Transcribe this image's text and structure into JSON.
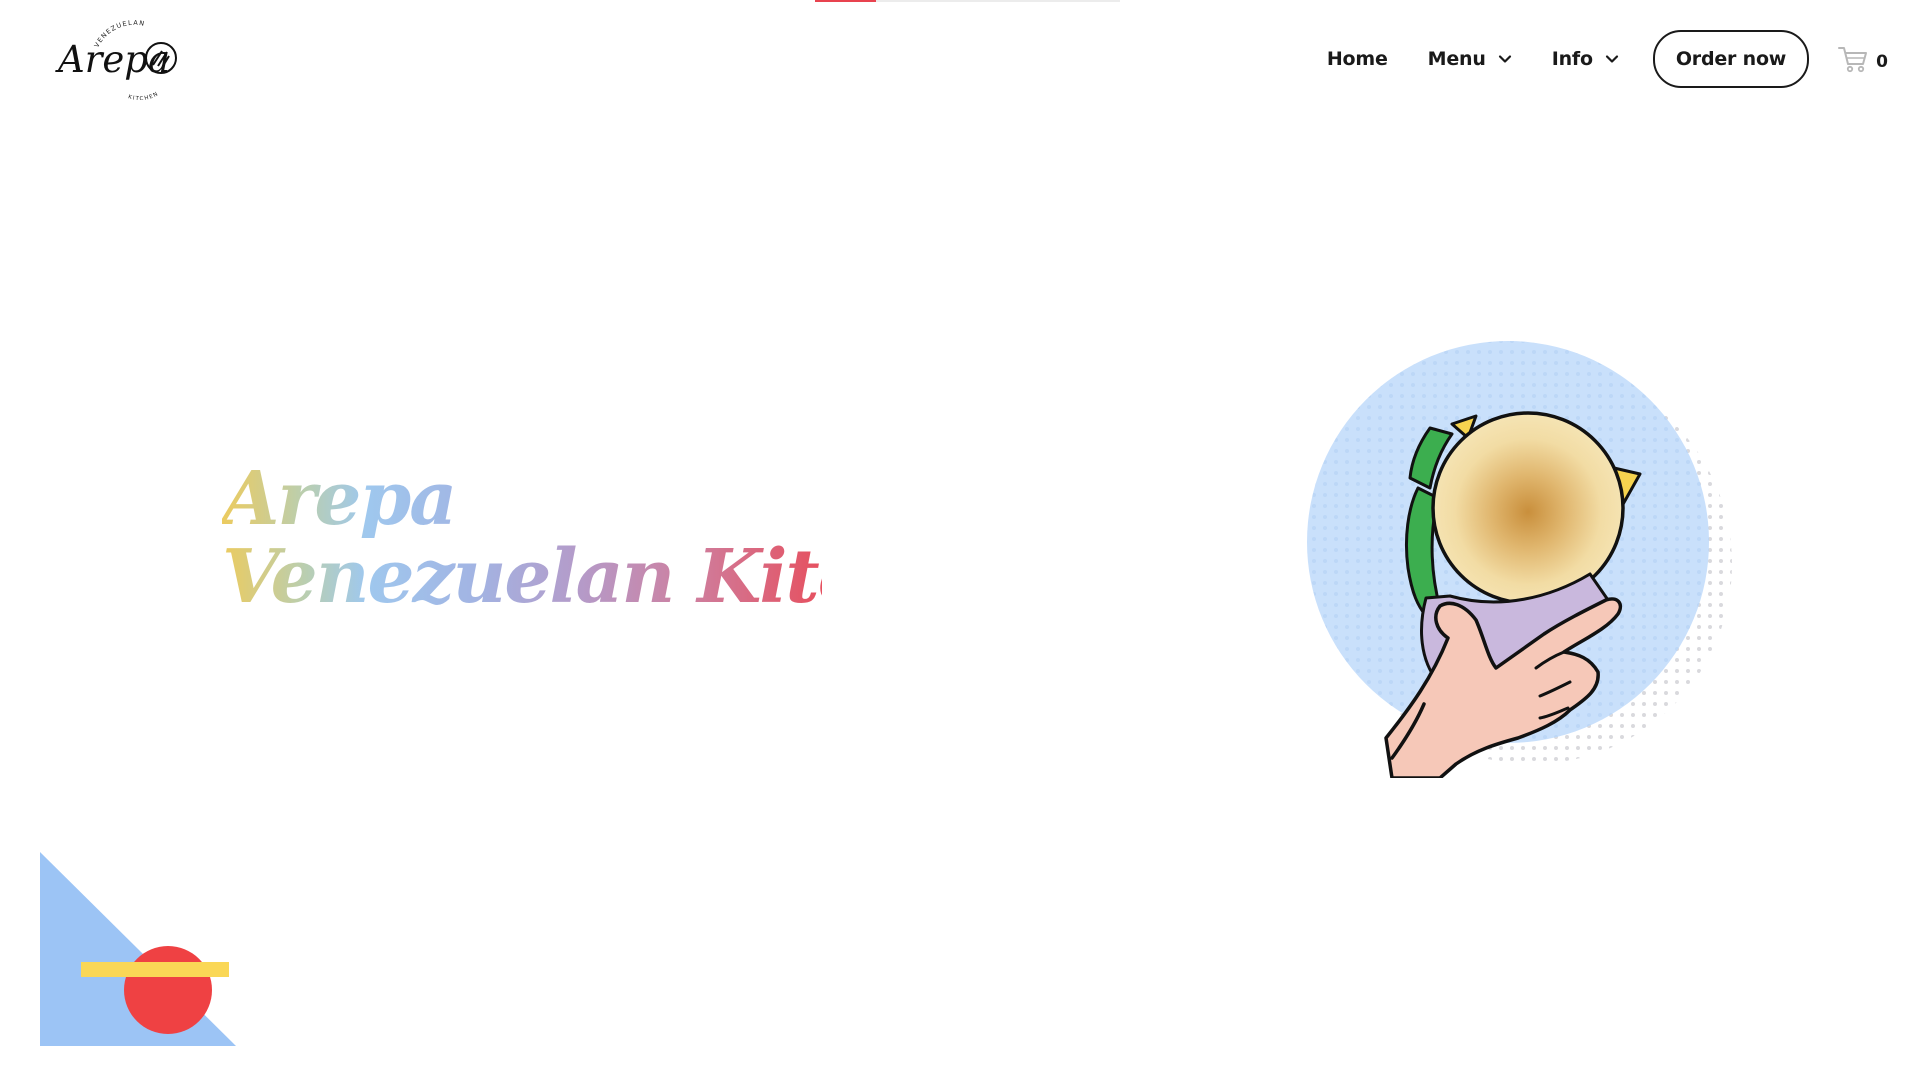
{
  "brand": {
    "logo_script": "Arepa",
    "logo_top_text": "VENEZUELAN",
    "logo_bottom_text": "KITCHEN"
  },
  "progress": {
    "value_fraction": 0.2
  },
  "nav": {
    "items": [
      {
        "label": "Home",
        "has_dropdown": false
      },
      {
        "label": "Menu",
        "has_dropdown": true
      },
      {
        "label": "Info",
        "has_dropdown": true
      }
    ],
    "order_button": "Order now",
    "cart_count": "0"
  },
  "hero": {
    "title_line1": "Arepa",
    "title_line2": "Venezuelan Kitchen"
  },
  "icons": {
    "chevron": "chevron-down-icon",
    "cart": "cart-icon"
  },
  "colors": {
    "text": "#1a1a1a",
    "accent_red": "#e8434f",
    "circle_blue": "#c9e0fb",
    "shape_blue": "#9cc4f5",
    "shape_red": "#ef4143",
    "shape_yellow": "#fad756",
    "title_gradient": [
      "#eccb5f",
      "#9fc8ee",
      "#b59ac8",
      "#e6505f"
    ]
  }
}
